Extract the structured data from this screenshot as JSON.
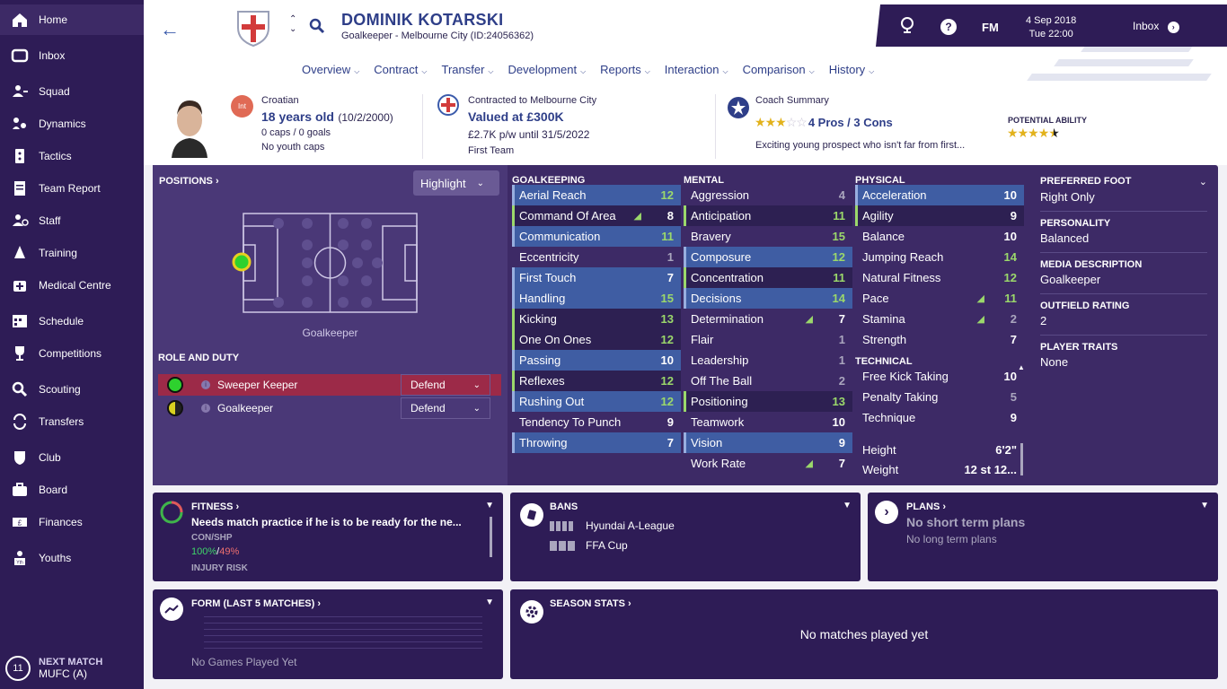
{
  "sidebar": {
    "items": [
      {
        "label": "Home",
        "icon": "home-icon"
      },
      {
        "label": "Inbox",
        "icon": "inbox-icon"
      },
      {
        "label": "Squad",
        "icon": "squad-icon"
      },
      {
        "label": "Dynamics",
        "icon": "dynamics-icon"
      },
      {
        "label": "Tactics",
        "icon": "tactics-icon"
      },
      {
        "label": "Team Report",
        "icon": "team-report-icon"
      },
      {
        "label": "Staff",
        "icon": "staff-icon"
      },
      {
        "label": "Training",
        "icon": "training-icon"
      },
      {
        "label": "Medical Centre",
        "icon": "medical-icon"
      },
      {
        "label": "Schedule",
        "icon": "schedule-icon"
      },
      {
        "label": "Competitions",
        "icon": "trophy-icon"
      },
      {
        "label": "Scouting",
        "icon": "scouting-icon"
      },
      {
        "label": "Transfers",
        "icon": "transfers-icon"
      },
      {
        "label": "Club",
        "icon": "club-icon"
      },
      {
        "label": "Board",
        "icon": "board-icon"
      },
      {
        "label": "Finances",
        "icon": "finances-icon"
      },
      {
        "label": "Youths",
        "icon": "youths-icon"
      }
    ],
    "next_match": {
      "number": "11",
      "label": "NEXT MATCH",
      "value": "MUFC (A)"
    }
  },
  "header": {
    "player_name": "DOMINIK KOTARSKI",
    "subtitle": "Goalkeeper - Melbourne City (ID:24056362)"
  },
  "topbar": {
    "fm": "FM",
    "date": "4 Sep 2018",
    "time": "Tue 22:00",
    "inbox": "Inbox"
  },
  "tabs": [
    {
      "label": "Overview"
    },
    {
      "label": "Contract"
    },
    {
      "label": "Transfer"
    },
    {
      "label": "Development"
    },
    {
      "label": "Reports"
    },
    {
      "label": "Interaction"
    },
    {
      "label": "Comparison"
    },
    {
      "label": "History"
    }
  ],
  "info": {
    "int_badge": "Int",
    "nationality": "Croatian",
    "age": "18 years old",
    "dob": "(10/2/2000)",
    "caps": "0 caps / 0 goals",
    "youth_caps": "No youth caps",
    "contract_label": "Contracted to Melbourne City",
    "value": "Valued at £300K",
    "wage": "£2.7K p/w until 31/5/2022",
    "squad": "First Team",
    "coach_label": "Coach Summary",
    "pros_cons": "4 Pros / 3 Cons",
    "coach_text": "Exciting young prospect who isn't far from first...",
    "potential_label": "POTENTIAL ABILITY",
    "current_stars": 3,
    "potential_stars": 4.5
  },
  "positions": {
    "title": "POSITIONS",
    "highlight": "Highlight",
    "position_label": "Goalkeeper",
    "role_title": "ROLE AND DUTY",
    "roles": [
      {
        "name": "Sweeper Keeper",
        "duty": "Defend",
        "color": "#2ed12e"
      },
      {
        "name": "Goalkeeper",
        "duty": "Defend",
        "color": "#d8d020"
      }
    ]
  },
  "attributes": {
    "goalkeeping": {
      "title": "GOALKEEPING",
      "items": [
        {
          "name": "Aerial Reach",
          "value": "12",
          "style": "hl1",
          "color": "g"
        },
        {
          "name": "Command Of Area",
          "value": "8",
          "style": "hl2",
          "color": "w",
          "arrow": true
        },
        {
          "name": "Communication",
          "value": "11",
          "style": "hl1",
          "color": "g"
        },
        {
          "name": "Eccentricity",
          "value": "1",
          "style": "plain",
          "color": "m"
        },
        {
          "name": "First Touch",
          "value": "7",
          "style": "hl1",
          "color": "w"
        },
        {
          "name": "Handling",
          "value": "15",
          "style": "hl1",
          "color": "g"
        },
        {
          "name": "Kicking",
          "value": "13",
          "style": "hl2",
          "color": "g"
        },
        {
          "name": "One On Ones",
          "value": "12",
          "style": "hl2",
          "color": "g"
        },
        {
          "name": "Passing",
          "value": "10",
          "style": "hl1",
          "color": "w"
        },
        {
          "name": "Reflexes",
          "value": "12",
          "style": "hl2",
          "color": "g"
        },
        {
          "name": "Rushing Out",
          "value": "12",
          "style": "hl1",
          "color": "g"
        },
        {
          "name": "Tendency To Punch",
          "value": "9",
          "style": "plain",
          "color": "w"
        },
        {
          "name": "Throwing",
          "value": "7",
          "style": "hl1",
          "color": "w"
        }
      ]
    },
    "mental": {
      "title": "MENTAL",
      "items": [
        {
          "name": "Aggression",
          "value": "4",
          "style": "plain",
          "color": "m"
        },
        {
          "name": "Anticipation",
          "value": "11",
          "style": "hl2",
          "color": "g"
        },
        {
          "name": "Bravery",
          "value": "15",
          "style": "plain",
          "color": "g"
        },
        {
          "name": "Composure",
          "value": "12",
          "style": "hl1",
          "color": "g"
        },
        {
          "name": "Concentration",
          "value": "11",
          "style": "hl2",
          "color": "g"
        },
        {
          "name": "Decisions",
          "value": "14",
          "style": "hl1",
          "color": "g"
        },
        {
          "name": "Determination",
          "value": "7",
          "style": "plain",
          "color": "w",
          "arrow": true
        },
        {
          "name": "Flair",
          "value": "1",
          "style": "plain",
          "color": "m"
        },
        {
          "name": "Leadership",
          "value": "1",
          "style": "plain",
          "color": "m"
        },
        {
          "name": "Off The Ball",
          "value": "2",
          "style": "plain",
          "color": "m"
        },
        {
          "name": "Positioning",
          "value": "13",
          "style": "hl2",
          "color": "g"
        },
        {
          "name": "Teamwork",
          "value": "10",
          "style": "plain",
          "color": "w"
        },
        {
          "name": "Vision",
          "value": "9",
          "style": "hl1",
          "color": "w"
        },
        {
          "name": "Work Rate",
          "value": "7",
          "style": "plain",
          "color": "w",
          "arrow": true
        }
      ]
    },
    "physical": {
      "title": "PHYSICAL",
      "items": [
        {
          "name": "Acceleration",
          "value": "10",
          "style": "hl1",
          "color": "w"
        },
        {
          "name": "Agility",
          "value": "9",
          "style": "hl2",
          "color": "w"
        },
        {
          "name": "Balance",
          "value": "10",
          "style": "plain",
          "color": "w"
        },
        {
          "name": "Jumping Reach",
          "value": "14",
          "style": "plain",
          "color": "g"
        },
        {
          "name": "Natural Fitness",
          "value": "12",
          "style": "plain",
          "color": "g"
        },
        {
          "name": "Pace",
          "value": "11",
          "style": "plain",
          "color": "g",
          "arrow": true
        },
        {
          "name": "Stamina",
          "value": "2",
          "style": "plain",
          "color": "m",
          "arrow": true
        },
        {
          "name": "Strength",
          "value": "7",
          "style": "plain",
          "color": "w"
        }
      ]
    },
    "technical": {
      "title": "TECHNICAL",
      "items": [
        {
          "name": "Free Kick Taking",
          "value": "10",
          "style": "plain",
          "color": "w"
        },
        {
          "name": "Penalty Taking",
          "value": "5",
          "style": "plain",
          "color": "m"
        },
        {
          "name": "Technique",
          "value": "9",
          "style": "plain",
          "color": "w"
        }
      ]
    },
    "height_label": "Height",
    "height": "6'2\"",
    "weight_label": "Weight",
    "weight": "12 st 12..."
  },
  "right_info": {
    "foot_label": "PREFERRED FOOT",
    "foot": "Right Only",
    "personality_label": "PERSONALITY",
    "personality": "Balanced",
    "media_label": "MEDIA DESCRIPTION",
    "media": "Goalkeeper",
    "outfield_label": "OUTFIELD RATING",
    "outfield": "2",
    "traits_label": "PLAYER TRAITS",
    "traits": "None"
  },
  "fitness": {
    "title": "FITNESS",
    "text": "Needs match practice if he is to be ready for the ne...",
    "con_label": "CON/SHP",
    "con": "100%",
    "slash": "/",
    "shp": "49%",
    "injury": "INJURY RISK"
  },
  "bans": {
    "title": "BANS",
    "items": [
      "Hyundai A-League",
      "FFA Cup"
    ]
  },
  "plans": {
    "title": "PLANS",
    "short": "No short term plans",
    "long": "No long term plans"
  },
  "form": {
    "title": "FORM (LAST 5 MATCHES)",
    "empty": "No Games Played Yet"
  },
  "season": {
    "title": "SEASON STATS",
    "empty": "No matches played yet"
  }
}
